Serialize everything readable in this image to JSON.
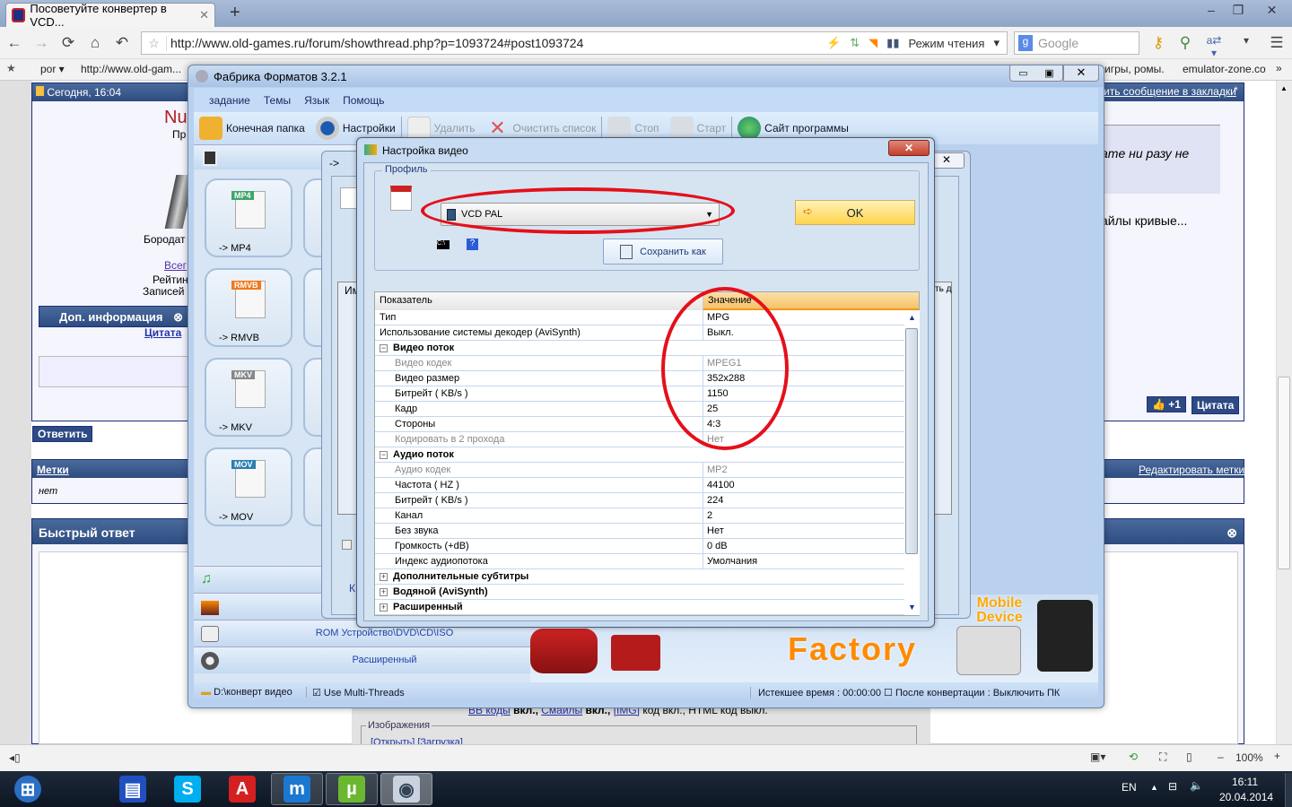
{
  "browser": {
    "tab_title": "Посоветуйте конвертер в VCD...",
    "url": "http://www.old-games.ru/forum/showthread.php?p=1093724#post1093724",
    "reading_mode": "Режим чтения",
    "search_placeholder": "Google",
    "bookmarks": [
      "por ▾",
      "http://www.old-gam...",
      "игры, ромы.",
      "emulator-zone.co",
      "»"
    ],
    "zoom": "100%"
  },
  "forum": {
    "post_date": "Сегодня, 16:04",
    "username_part": "Nu",
    "user_title_part": "Пр",
    "user_rank_part": "Бородат",
    "all_link_part": "Всег",
    "rating_part": "Рейтин",
    "records_part": "Записей",
    "more_info": "Доп. информация",
    "quote_link": "Цитата",
    "bookmark_link": "ить сообщение в закладки",
    "quote_text_part": "ате ни разу не",
    "post_text_part": "айлы кривые...",
    "plus_one": "+1",
    "quote_button": "Цитата",
    "reply_button": "Ответить",
    "tags_title": "Метки",
    "tags_value": "нет",
    "edit_tags": "Редактировать метки",
    "quick_reply": "Быстрый ответ",
    "bbcode_line": {
      "bb": "ВВ коды",
      "bb_on": " вкл., ",
      "smiles": "Смайлы",
      "smiles_on": " вкл., ",
      "img": "[IMG]",
      "img_on": " код вкл., HTML код выкл."
    },
    "images_legend": "Изображения",
    "images_links": "[Открыть] [Загрузка]"
  },
  "app": {
    "title": "Фабрика Форматов 3.2.1",
    "menu": [
      "задание",
      "Темы",
      "Язык",
      "Помощь"
    ],
    "toolbar": [
      {
        "label": "Конечная папка",
        "enabled": true
      },
      {
        "label": "Настройки",
        "enabled": true
      },
      {
        "label": "Удалить",
        "enabled": false
      },
      {
        "label": "Очистить список",
        "enabled": false
      },
      {
        "label": "Стоп",
        "enabled": false
      },
      {
        "label": "Старт",
        "enabled": false
      },
      {
        "label": "Сайт программы",
        "enabled": true
      }
    ],
    "formats": [
      {
        "badge": "MP4",
        "label": "-> MP4",
        "color": "#3fa66a"
      },
      {
        "badge": "RMVB",
        "label": "-> RMVB",
        "color": "#f07a1e"
      },
      {
        "badge": "MKV",
        "label": "-> MKV",
        "color": "#888888"
      },
      {
        "badge": "MOV",
        "label": "-> MOV",
        "color": "#2a7fb0"
      }
    ],
    "categories": {
      "rom": "ROM Устройство\\DVD\\CD\\ISO",
      "advanced": "Расширенный"
    },
    "banner_text": "Factory",
    "mobile_text": "Mobile Device",
    "status": {
      "folder": "D:\\конверт видео",
      "multithreads": "Use Multi-Threads",
      "elapsed": "Истекшее время : 00:00:00",
      "after": "После конвертации : Выключить ПК"
    },
    "dialog2": {
      "title_part": "->",
      "col_part": "Им",
      "col_right_part": "ть д",
      "bottom_part": "К"
    }
  },
  "dialog": {
    "title": "Настройка видео",
    "profile_legend": "Профиль",
    "profile_value": "VCD PAL",
    "ok": "OK",
    "save_as": "Сохранить как",
    "col_param": "Показатель",
    "col_value": "Значение",
    "rows": [
      {
        "k": "Тип",
        "v": "MPG",
        "type": "top"
      },
      {
        "k": "Использование системы декодер (AviSynth)",
        "v": "Выкл.",
        "type": "top"
      },
      {
        "k": "Видео поток",
        "v": "",
        "type": "grp",
        "sign": "−"
      },
      {
        "k": "Видео кодек",
        "v": "MPEG1",
        "type": "dim"
      },
      {
        "k": "Видео размер",
        "v": "352x288",
        "type": "sub"
      },
      {
        "k": "Битрейт ( KB/s )",
        "v": "1150",
        "type": "sub"
      },
      {
        "k": "Кадр",
        "v": "25",
        "type": "sub"
      },
      {
        "k": "Стороны",
        "v": "4:3",
        "type": "sub"
      },
      {
        "k": "Кодировать в 2 прохода",
        "v": "Нет",
        "type": "dim"
      },
      {
        "k": "Аудио поток",
        "v": "",
        "type": "grp",
        "sign": "−"
      },
      {
        "k": "Аудио кодек",
        "v": "MP2",
        "type": "dim"
      },
      {
        "k": "Частота ( HZ )",
        "v": "44100",
        "type": "sub"
      },
      {
        "k": "Битрейт ( KB/s )",
        "v": "224",
        "type": "sub"
      },
      {
        "k": "Канал",
        "v": "2",
        "type": "sub"
      },
      {
        "k": "Без звука",
        "v": "Нет",
        "type": "sub"
      },
      {
        "k": "Громкость (+dB)",
        "v": "0 dB",
        "type": "sub"
      },
      {
        "k": "Индекс аудиопотока",
        "v": "Умолчания",
        "type": "sub"
      },
      {
        "k": "Дополнительные субтитры",
        "v": "",
        "type": "grp",
        "sign": "+"
      },
      {
        "k": "Водяной (AviSynth)",
        "v": "",
        "type": "grp",
        "sign": "+"
      },
      {
        "k": "Расширенный",
        "v": "",
        "type": "grp",
        "sign": "+"
      }
    ]
  },
  "taskbar": {
    "items": [
      {
        "name": "start",
        "glyph": "⊞",
        "bg": "#2a6fc4"
      },
      {
        "name": "floppy",
        "glyph": "▤",
        "bg": "#2050c0"
      },
      {
        "name": "skype",
        "glyph": "S",
        "bg": "#00aff0"
      },
      {
        "name": "acrobat",
        "glyph": "A",
        "bg": "#d42020"
      },
      {
        "name": "maxthon",
        "glyph": "m",
        "bg": "#1a78d0"
      },
      {
        "name": "utorrent",
        "glyph": "µ",
        "bg": "#6bb830"
      },
      {
        "name": "format-factory",
        "glyph": "◉",
        "bg": "#c9d3df"
      }
    ],
    "lang": "EN",
    "time": "16:11",
    "date": "20.04.2014"
  }
}
